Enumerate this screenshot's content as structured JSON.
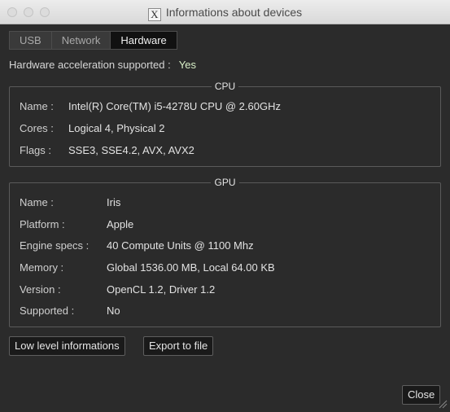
{
  "window": {
    "title": "Informations about devices",
    "app_icon_glyph": "X"
  },
  "tabs": [
    {
      "label": "USB",
      "active": false
    },
    {
      "label": "Network",
      "active": false
    },
    {
      "label": "Hardware",
      "active": true
    }
  ],
  "acceleration": {
    "label": "Hardware acceleration supported :",
    "value": "Yes"
  },
  "cpu": {
    "title": "CPU",
    "rows": [
      {
        "label": "Name :",
        "value": "Intel(R) Core(TM) i5-4278U CPU @ 2.60GHz"
      },
      {
        "label": "Cores :",
        "value": "Logical 4, Physical 2"
      },
      {
        "label": "Flags :",
        "value": "SSE3, SSE4.2, AVX, AVX2"
      }
    ]
  },
  "gpu": {
    "title": "GPU",
    "rows": [
      {
        "label": "Name :",
        "value": "Iris"
      },
      {
        "label": "Platform :",
        "value": "Apple"
      },
      {
        "label": "Engine specs :",
        "value": "40 Compute Units @ 1100 Mhz"
      },
      {
        "label": "Memory :",
        "value": "Global 1536.00 MB, Local 64.00 KB"
      },
      {
        "label": "Version :",
        "value": "OpenCL 1.2, Driver 1.2"
      },
      {
        "label": "Supported :",
        "value": "No"
      }
    ]
  },
  "buttons": {
    "low_level": "Low level informations",
    "export": "Export to file",
    "close": "Close"
  },
  "colors": {
    "background": "#2b2b2b",
    "active_tab": "#111111",
    "yes_text": "#d9f0c8"
  }
}
